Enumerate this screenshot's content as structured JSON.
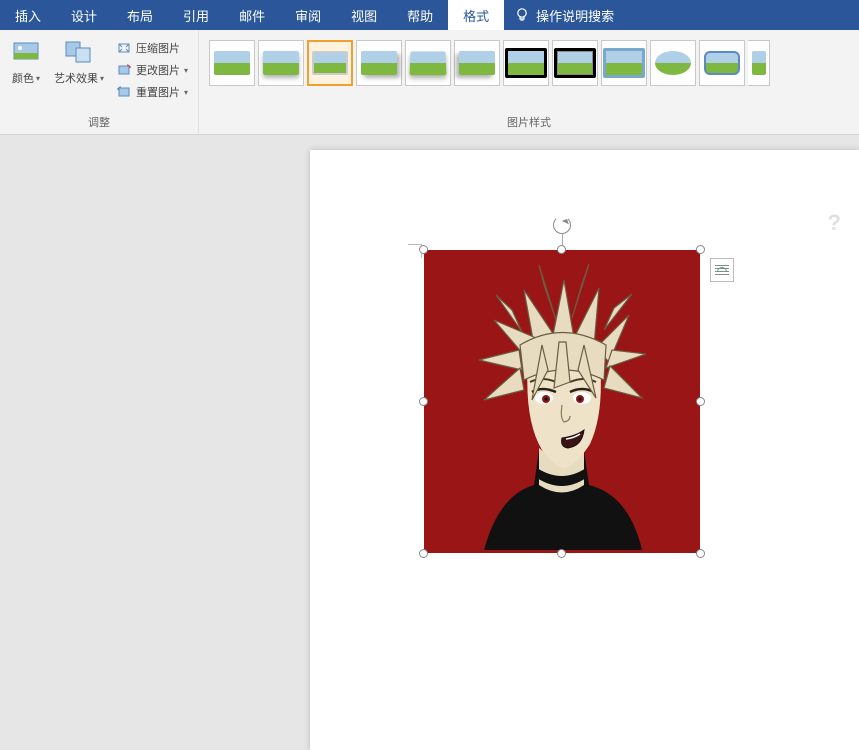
{
  "tabs": {
    "insert": "插入",
    "design": "设计",
    "layout": "布局",
    "references": "引用",
    "mailings": "邮件",
    "review": "审阅",
    "view": "视图",
    "help": "帮助",
    "format": "格式"
  },
  "tell_me": "操作说明搜索",
  "ribbon": {
    "adjust": {
      "color": "颜色",
      "artistic": "艺术效果",
      "compress": "压缩图片",
      "change": "更改图片",
      "reset": "重置图片",
      "group_label": "调整"
    },
    "styles": {
      "group_label": "图片样式"
    }
  }
}
